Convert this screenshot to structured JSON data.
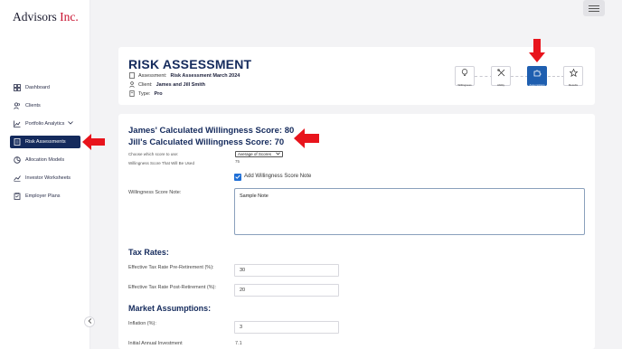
{
  "app": {
    "logo_main": "Advisors",
    "logo_inc": "Inc."
  },
  "sidebar": {
    "items": [
      {
        "label": "Dashboard",
        "icon": "grid-icon"
      },
      {
        "label": "Clients",
        "icon": "users-icon"
      },
      {
        "label": "Portfolio Analytics",
        "icon": "chart-icon"
      },
      {
        "label": "Risk Assessments",
        "icon": "document-icon"
      },
      {
        "label": "Allocation Models",
        "icon": "pie-icon"
      },
      {
        "label": "Investor Worksheets",
        "icon": "line-chart-icon"
      },
      {
        "label": "Employer Plans",
        "icon": "clipboard-icon"
      }
    ],
    "active_item": "Risk Assessments"
  },
  "header": {
    "title": "RISK ASSESSMENT",
    "assessment_label": "Assessment:",
    "assessment_value": "Risk Assessment March 2024",
    "client_label": "Client:",
    "client_value": "James and Jill Smith",
    "type_label": "Type:",
    "type_value": "Pro"
  },
  "steps": [
    {
      "label": "Willingness",
      "icon": "lightbulb-icon"
    },
    {
      "label": "Ability",
      "icon": "tools-icon"
    },
    {
      "label": "Assumptions",
      "icon": "puzzle-icon"
    },
    {
      "label": "Results",
      "icon": "star-icon"
    }
  ],
  "active_step": "Assumptions",
  "willingness": {
    "james_score_line": "James' Calculated Willingness Score: 80",
    "jill_score_line": "Jill's Calculated Willingness Score: 70",
    "choose_label": "Choose which score to use:",
    "select_value": "Average of Scores",
    "used_label": "Willingness Score That Will Be Used",
    "used_value": "75",
    "add_note_label": "Add Willingness Score Note",
    "note_label": "Willingness Score Note:",
    "note_value": "Sample Note"
  },
  "tax_rates": {
    "title": "Tax Rates:",
    "pre_label": "Effective Tax Rate Pre-Retirement (%):",
    "pre_value": "30",
    "post_label": "Effective Tax Rate Post-Retirement (%):",
    "post_value": "20"
  },
  "market": {
    "title": "Market Assumptions:",
    "inflation_label": "Inflation (%):",
    "inflation_value": "3",
    "initial_label": "Initial Annual Investment",
    "initial_value": "7.1"
  },
  "colors": {
    "navy": "#142a5c",
    "accent_blue": "#1f5fb0",
    "arrow_red": "#e8141c",
    "logo_red": "#c8102e"
  }
}
